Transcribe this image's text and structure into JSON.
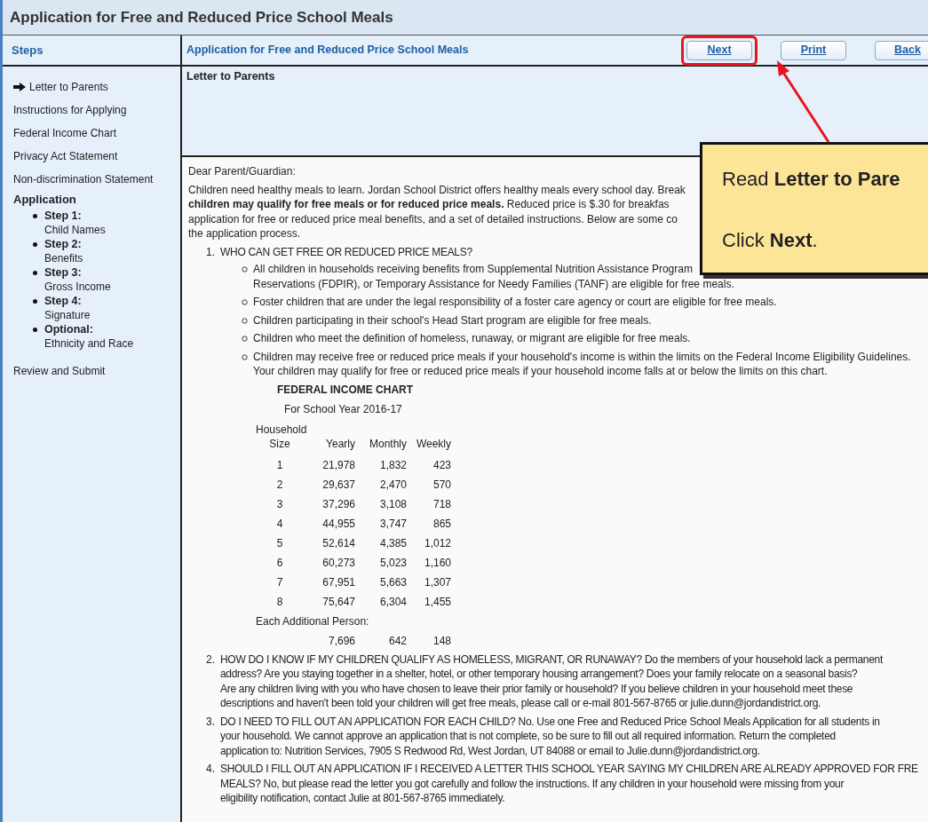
{
  "window": {
    "title": "Application for Free and Reduced Price School Meals"
  },
  "sidebar": {
    "header": "Steps",
    "items": [
      {
        "kind": "link",
        "label": "Letter to Parents",
        "selected": true
      },
      {
        "kind": "link",
        "label": "Instructions for Applying",
        "selected": false
      },
      {
        "kind": "link",
        "label": "Federal Income Chart",
        "selected": false
      },
      {
        "kind": "link",
        "label": "Privacy Act Statement",
        "selected": false
      },
      {
        "kind": "link",
        "label": "Non-discrimination Statement",
        "selected": false
      },
      {
        "kind": "group",
        "label": "Application",
        "children": [
          {
            "label": "Step 1:",
            "sublabel": "Child Names"
          },
          {
            "label": "Step 2:",
            "sublabel": "Benefits"
          },
          {
            "label": "Step 3:",
            "sublabel": "Gross Income"
          },
          {
            "label": "Step 4:",
            "sublabel": "Signature"
          },
          {
            "label": "Optional:",
            "sublabel": "Ethnicity and Race"
          }
        ]
      },
      {
        "kind": "link",
        "label": "Review and Submit",
        "selected": false
      }
    ]
  },
  "header": {
    "title": "Application for Free and Reduced Price School Meals",
    "buttons": [
      {
        "label": "Next",
        "highlighted": true
      },
      {
        "label": "Print",
        "highlighted": false
      },
      {
        "label": "Back",
        "highlighted": false
      }
    ]
  },
  "section_title": "Letter to Parents",
  "callout": {
    "lines": [
      "Read **Letter to Pare**",
      "Click **Next**."
    ]
  },
  "letter": {
    "greeting": "Dear Parent/Guardian:",
    "intro": [
      "Children need healthy meals to learn. Jordan School District offers healthy meals every school day. Break",
      "**children may qualify for free meals or for reduced price meals.** Reduced price is $.30 for breakfas",
      "application for free or reduced price meal benefits, and a set of detailed instructions. Below are some co",
      "the application process."
    ],
    "questions": [
      {
        "number": "1.",
        "lines": [
          "WHO CAN GET FREE OR REDUCED PRICE MEALS?"
        ],
        "bullets": [
          [
            "All children in households receiving benefits from Supplemental Nutrition Assistance Program",
            "Reservations (FDPIR), or Temporary Assistance for Needy Families (TANF) are eligible for free meals."
          ],
          [
            "Foster children that are under the legal responsibility of a foster care agency or court are eligible for free meals."
          ],
          [
            "Children participating in their school's Head Start program are eligible for free meals."
          ],
          [
            "Children who meet the definition of homeless, runaway, or migrant are eligible for free meals."
          ],
          [
            "Children may receive free or reduced price meals if your household's income is within the limits on the Federal Income Eligibility Guidelines.",
            "Your children may qualify for free or reduced price meals if your household income falls at or below the limits on this chart."
          ]
        ],
        "income_chart": {
          "title": "FEDERAL INCOME CHART",
          "subtitle": "For School Year 2016-17",
          "size_label_1": "Household",
          "columns": [
            "Size",
            "Yearly",
            "Monthly",
            "Weekly"
          ],
          "rows": [
            [
              "1",
              "21,978",
              "1,832",
              "423"
            ],
            [
              "2",
              "29,637",
              "2,470",
              "570"
            ],
            [
              "3",
              "37,296",
              "3,108",
              "718"
            ],
            [
              "4",
              "44,955",
              "3,747",
              "865"
            ],
            [
              "5",
              "52,614",
              "4,385",
              "1,012"
            ],
            [
              "6",
              "60,273",
              "5,023",
              "1,160"
            ],
            [
              "7",
              "67,951",
              "5,663",
              "1,307"
            ],
            [
              "8",
              "75,647",
              "6,304",
              "1,455"
            ]
          ],
          "additional_label": "Each Additional Person:",
          "additional": [
            "7,696",
            "642",
            "148"
          ]
        }
      },
      {
        "number": "2.",
        "lines": [
          "HOW DO I KNOW IF MY CHILDREN QUALIFY AS HOMELESS, MIGRANT, OR RUNAWAY? Do the members of your household lack a permanent",
          "address? Are you staying together in a shelter, hotel, or other temporary housing arrangement? Does your family relocate on a seasonal basis?",
          "Are any children living with you who have chosen to leave their prior family or household? If you believe children in your household meet these",
          "descriptions and haven't been told your children will get free meals, please call or e-mail 801-567-8765 or julie.dunn@jordandistrict.org."
        ]
      },
      {
        "number": "3.",
        "lines": [
          "DO I NEED TO FILL OUT AN APPLICATION FOR EACH CHILD? No. Use one Free and Reduced Price School Meals Application for all students in",
          "your household. We cannot approve an application that is not complete, so be sure to fill out all required information. Return the completed",
          "application to: Nutrition Services, 7905 S Redwood Rd, West Jordan, UT 84088 or email to Julie.dunn@jordandistrict.org."
        ]
      },
      {
        "number": "4.",
        "lines": [
          "SHOULD I FILL OUT AN APPLICATION IF I RECEIVED A LETTER THIS SCHOOL YEAR SAYING MY CHILDREN ARE ALREADY APPROVED FOR FRE",
          "MEALS? No, but please read the letter you got carefully and follow the instructions. If any children in your household were missing from your",
          "eligibility notification, contact Julie at 801-567-8765 immediately."
        ]
      }
    ]
  }
}
